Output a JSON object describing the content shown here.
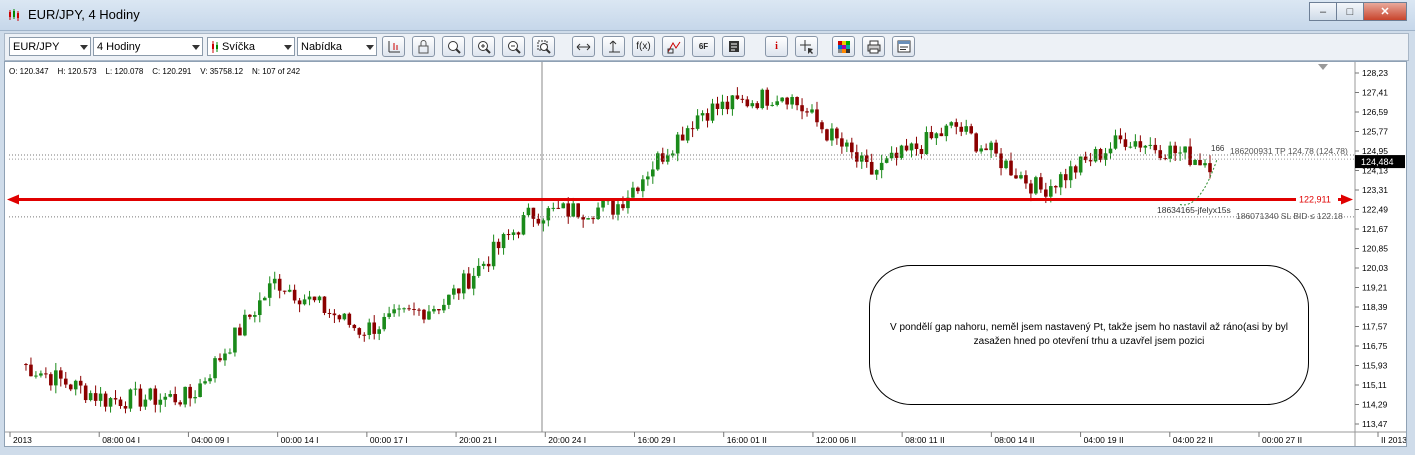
{
  "window": {
    "title": "EUR/JPY,  4 Hodiny",
    "min_label": "–",
    "max_label": "□",
    "close_label": "✕"
  },
  "toolbar": {
    "symbol": "EUR/JPY",
    "period": "4 Hodiny",
    "chart_type": "Svíčka",
    "price_side": "Nabídka",
    "button_labels": [
      "f(x)",
      "6F",
      "i"
    ]
  },
  "chart": {
    "ohlc_info": "O: 120.347    H: 120.573    L: 120.078    C: 120.291    V: 35758.12    N: 107 of 242",
    "price_labels": [
      "128,23",
      "127,41",
      "126,59",
      "125,77",
      "124,95",
      "124,13",
      "123,31",
      "122,49",
      "121,67",
      "120,85",
      "120,03",
      "119,21",
      "118,39",
      "117,57",
      "116,75",
      "115,93",
      "115,11",
      "114,29",
      "113,47"
    ],
    "time_labels": [
      "2013",
      "08:00 04 I",
      "04:00 09 I",
      "00:00 14 I",
      "00:00 17 I",
      "20:00 21 I",
      "20:00 24 I",
      "16:00 29 I",
      "16:00 01 II",
      "12:00 06 II",
      "08:00 11 II",
      "08:00 14 II",
      "04:00 19 II",
      "04:00 22 II",
      "00:00 27 II",
      "II 2013"
    ],
    "current_price": "124,484",
    "line_price": "122,911",
    "tp_label": "186200931 TP 124.78 (124.78)",
    "sl_label": "186071340 SL BID ≤ 122.18",
    "order_label": "18634165-jfelyx15s",
    "count_label": "166",
    "colors": {
      "bull": "#1a8a1a",
      "bear": "#8b0000",
      "hline": "#e00000",
      "current_bg": "#000000"
    }
  },
  "note": {
    "text": "V pondělí gap nahoru, neměl jsem nastavený Pt, takže jsem ho nastavil  až ráno(asi by byl zasažen hned po otevření trhu a  uzavřel jsem pozici"
  },
  "chart_data": {
    "type": "candlestick",
    "symbol": "EUR/JPY",
    "timeframe": "4 Hodiny",
    "x_range": [
      "2013-01-02",
      "2013-02-27"
    ],
    "y_range": [
      113.47,
      128.23
    ],
    "key_points": [
      {
        "time": "2013-01-02",
        "close": 116.0
      },
      {
        "time": "2013-01-04",
        "close": 114.5
      },
      {
        "time": "2013-01-09",
        "close": 114.6
      },
      {
        "time": "2013-01-14",
        "close": 119.5
      },
      {
        "time": "2013-01-17",
        "close": 117.4
      },
      {
        "time": "2013-01-21",
        "close": 118.6
      },
      {
        "time": "2013-01-24",
        "close": 122.3
      },
      {
        "time": "2013-01-29",
        "close": 122.6
      },
      {
        "time": "2013-02-01",
        "close": 126.6
      },
      {
        "time": "2013-02-03",
        "close": 127.4
      },
      {
        "time": "2013-02-06",
        "close": 124.0
      },
      {
        "time": "2013-02-11",
        "close": 126.0
      },
      {
        "time": "2013-02-14",
        "close": 123.3
      },
      {
        "time": "2013-02-19",
        "close": 125.5
      },
      {
        "time": "2013-02-22",
        "close": 124.48
      }
    ],
    "horizontal_lines": [
      122.911,
      124.78,
      122.18
    ]
  }
}
